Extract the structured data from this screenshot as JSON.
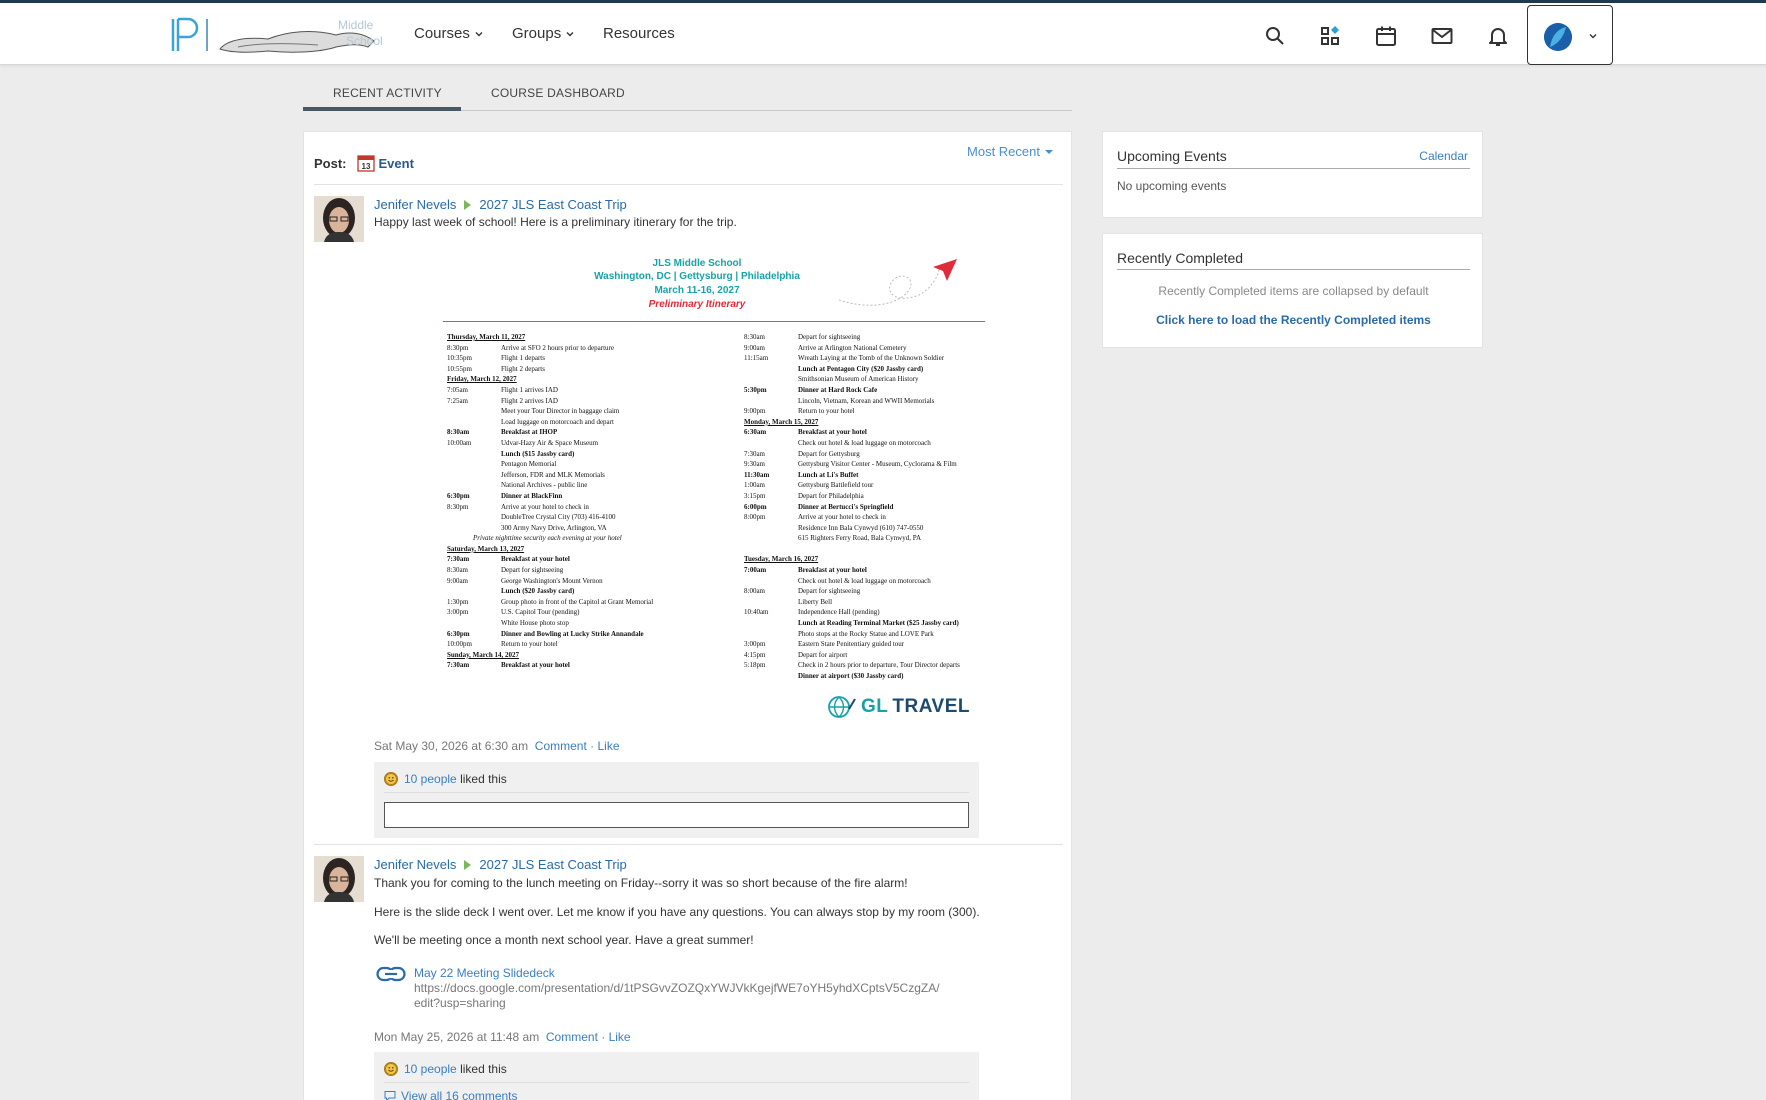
{
  "brand": {
    "school_line1": "Middle",
    "school_line2": "School"
  },
  "nav": {
    "courses": "Courses",
    "groups": "Groups",
    "resources": "Resources"
  },
  "tabs": {
    "recent_activity": "RECENT ACTIVITY",
    "course_dashboard": "COURSE DASHBOARD"
  },
  "post_bar": {
    "label": "Post:",
    "event": "Event",
    "sort": "Most Recent",
    "calendar_day": "13"
  },
  "posts": [
    {
      "author": "Jenifer Nevels",
      "group": "2027 JLS East Coast Trip",
      "text": "Happy last week of school! Here is a preliminary itinerary for the trip.",
      "timestamp": "Sat May 30, 2026 at 6:30 am",
      "comment": "Comment",
      "sep": "·",
      "like": "Like",
      "likes_count": "10 people",
      "likes_suffix": "liked this"
    },
    {
      "author": "Jenifer Nevels",
      "group": "2027 JLS East Coast Trip",
      "text1": "Thank you for coming to the lunch meeting on Friday--sorry it was so short because of the fire alarm!",
      "text2": "Here is the slide deck I went over. Let me know if you have any questions. You can always stop by my room (300).",
      "text3": "We'll be meeting once a month next school year. Have a great summer!",
      "link_title": "May 22 Meeting Slidedeck",
      "link_url1": "https://docs.google.com/presentation/d/1tPSGvvZOZQxYWJVkKgejfWE7oYH5yhdXCptsV5CzgZA/",
      "link_url2": "edit?usp=sharing",
      "timestamp": "Mon May 25, 2026 at 11:48 am",
      "comment": "Comment",
      "sep": "·",
      "like": "Like",
      "likes_count": "10 people",
      "likes_suffix": "liked this",
      "view_comments": "View all 16 comments"
    }
  ],
  "itinerary": {
    "school": "JLS Middle School",
    "cities": "Washington, DC | Gettysburg | Philadelphia",
    "dates": "March 11-16, 2027",
    "subtitle": "Preliminary Itinerary",
    "left": [
      {
        "t": "Thursday, March 11, 2027",
        "d": "",
        "s": "h"
      },
      {
        "t": "8:30pm",
        "d": "Arrive at SFO 2 hours prior to departure",
        "s": ""
      },
      {
        "t": "10:35pm",
        "d": "Flight 1 departs",
        "s": ""
      },
      {
        "t": "10:55pm",
        "d": "Flight 2 departs",
        "s": ""
      },
      {
        "t": "Friday, March 12, 2027",
        "d": "",
        "s": "h"
      },
      {
        "t": "7:05am",
        "d": "Flight 1 arrives IAD",
        "s": ""
      },
      {
        "t": "7:25am",
        "d": "Flight 2 arrives IAD",
        "s": ""
      },
      {
        "t": "",
        "d": "Meet your Tour Director in baggage claim",
        "s": ""
      },
      {
        "t": "",
        "d": "Load luggage on motorcoach and depart",
        "s": ""
      },
      {
        "t": "8:30am",
        "d": "Breakfast at IHOP",
        "s": "b"
      },
      {
        "t": "10:00am",
        "d": "Udvar-Hazy Air & Space Museum",
        "s": ""
      },
      {
        "t": "",
        "d": "Lunch ($15 Jassby card)",
        "s": "b"
      },
      {
        "t": "",
        "d": "Pentagon Memorial",
        "s": ""
      },
      {
        "t": "",
        "d": "Jefferson, FDR and MLK Memorials",
        "s": ""
      },
      {
        "t": "",
        "d": "National Archives - public line",
        "s": ""
      },
      {
        "t": "6:30pm",
        "d": "Dinner at BlackFinn",
        "s": "b"
      },
      {
        "t": "8:30pm",
        "d": "Arrive at your hotel to check in",
        "s": ""
      },
      {
        "t": "",
        "d": "DoubleTree Crystal City  (703) 416-4100",
        "s": ""
      },
      {
        "t": "",
        "d": "300 Army Navy Drive, Arlington, VA",
        "s": ""
      },
      {
        "t": "",
        "d": "Private nighttime security each evening at your hotel",
        "s": "note"
      },
      {
        "t": "Saturday, March 13, 2027",
        "d": "",
        "s": "h"
      },
      {
        "t": "7:30am",
        "d": "Breakfast at your hotel",
        "s": "b"
      },
      {
        "t": "8:30am",
        "d": "Depart for sightseeing",
        "s": ""
      },
      {
        "t": "9:00am",
        "d": "George Washington's Mount Vernon",
        "s": ""
      },
      {
        "t": "",
        "d": "Lunch ($20 Jassby card)",
        "s": "b"
      },
      {
        "t": "1:30pm",
        "d": "Group photo in front of the Capitol at Grant Memorial",
        "s": ""
      },
      {
        "t": "3:00pm",
        "d": "U.S. Capitol Tour (pending)",
        "s": ""
      },
      {
        "t": "",
        "d": "White House photo stop",
        "s": ""
      },
      {
        "t": "6:30pm",
        "d": "Dinner and Bowling at Lucky Strike Annandale",
        "s": "b"
      },
      {
        "t": "10:00pm",
        "d": "Return to your hotel",
        "s": ""
      },
      {
        "t": "Sunday, March 14, 2027",
        "d": "",
        "s": "h"
      },
      {
        "t": "7:30am",
        "d": "Breakfast at your hotel",
        "s": "b"
      }
    ],
    "right": [
      {
        "t": "8:30am",
        "d": "Depart for sightseeing",
        "s": ""
      },
      {
        "t": "9:00am",
        "d": "Arrive at Arlington National Cemetery",
        "s": ""
      },
      {
        "t": "11:15am",
        "d": "Wreath Laying at the Tomb of the Unknown Soldier",
        "s": ""
      },
      {
        "t": "",
        "d": "Lunch at Pentagon City ($20 Jassby card)",
        "s": "b"
      },
      {
        "t": "",
        "d": "Smithsonian Museum of American History",
        "s": ""
      },
      {
        "t": "5:30pm",
        "d": "Dinner at Hard Rock Cafe",
        "s": "b"
      },
      {
        "t": "",
        "d": "Lincoln, Vietnam, Korean and WWII Memorials",
        "s": ""
      },
      {
        "t": "9:00pm",
        "d": "Return to your hotel",
        "s": ""
      },
      {
        "t": "Monday, March 15, 2027",
        "d": "",
        "s": "h"
      },
      {
        "t": "6:30am",
        "d": "Breakfast at your hotel",
        "s": "b"
      },
      {
        "t": "",
        "d": "Check out hotel & load luggage on motorcoach",
        "s": ""
      },
      {
        "t": "7:30am",
        "d": "Depart for Gettysburg",
        "s": ""
      },
      {
        "t": "9:30am",
        "d": "Gettysburg Visitor Center - Museum, Cyclorama & Film",
        "s": ""
      },
      {
        "t": "11:30am",
        "d": "Lunch at Li's Buffet",
        "s": "b"
      },
      {
        "t": "1:00am",
        "d": "Gettysburg Battlefield tour",
        "s": ""
      },
      {
        "t": "3:15pm",
        "d": "Depart for Philadelphia",
        "s": ""
      },
      {
        "t": "6:00pm",
        "d": "Dinner at Bertucci's Springfield",
        "s": "b"
      },
      {
        "t": "8:00pm",
        "d": "Arrive at your hotel to check in",
        "s": ""
      },
      {
        "t": "",
        "d": "Residence Inn Bala Cynwyd  (610) 747-0550",
        "s": ""
      },
      {
        "t": "",
        "d": "615 Righters Ferry Road, Bala Cynwyd, PA",
        "s": ""
      },
      {
        "t": "",
        "d": "",
        "s": ""
      },
      {
        "t": "Tuesday, March 16, 2027",
        "d": "",
        "s": "h"
      },
      {
        "t": "7:00am",
        "d": "Breakfast at your hotel",
        "s": "b"
      },
      {
        "t": "",
        "d": "Check out hotel & load luggage on motorcoach",
        "s": ""
      },
      {
        "t": "8:00am",
        "d": "Depart for sightseeing",
        "s": ""
      },
      {
        "t": "",
        "d": "Liberty Bell",
        "s": ""
      },
      {
        "t": "10:40am",
        "d": "Independence Hall (pending)",
        "s": ""
      },
      {
        "t": "",
        "d": "Lunch at Reading Terminal Market ($25 Jassby card)",
        "s": "b"
      },
      {
        "t": "",
        "d": "Photo stops at the Rocky Statue and LOVE Park",
        "s": ""
      },
      {
        "t": "3:00pm",
        "d": "Eastern State Penitentiary guided tour",
        "s": ""
      },
      {
        "t": "4:15pm",
        "d": "Depart for airport",
        "s": ""
      },
      {
        "t": "5:18pm",
        "d": "Check in 2 hours prior to departure, Tour Director departs",
        "s": ""
      },
      {
        "t": "",
        "d": "Dinner at airport ($30 Jassby card)",
        "s": "b"
      }
    ],
    "logo_gl": "GL",
    "logo_travel": "TRAVEL"
  },
  "sidebar": {
    "upcoming_title": "Upcoming Events",
    "calendar_link": "Calendar",
    "no_events": "No upcoming events",
    "completed_title": "Recently Completed",
    "completed_note": "Recently Completed items are collapsed by default",
    "completed_link": "Click here to load the Recently Completed items"
  },
  "colors": {
    "accent": "#3a7ec2",
    "topbar_border": "#1d3a4f",
    "tab_underline": "#4a5864",
    "itinerary_teal": "#17a2a8",
    "itinerary_red": "#e02b3a"
  }
}
